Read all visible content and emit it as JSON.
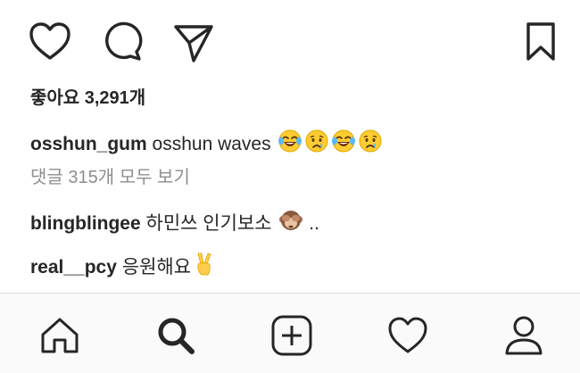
{
  "post": {
    "likes_text": "좋아요 3,291개",
    "caption": {
      "username": "osshun_gum",
      "text": "osshun waves",
      "emojis": [
        "face-with-tears-of-joy",
        "crying-face",
        "face-with-tears-of-joy",
        "crying-face"
      ]
    },
    "view_all_comments": "댓글 315개 모두 보기",
    "comments": [
      {
        "username": "blingblingee",
        "text": "하민쓰 인기보소",
        "emoji": "see-no-evil-monkey",
        "suffix": ".."
      },
      {
        "username": "real__pcy",
        "text": "응원해요",
        "emoji": "victory-hand"
      }
    ]
  },
  "actions": [
    "heart-icon",
    "comment-icon",
    "share-icon",
    "bookmark-icon"
  ],
  "tabbar": {
    "tabs": [
      "home-icon",
      "search-icon",
      "new-post-icon",
      "activity-icon",
      "profile-icon"
    ],
    "active_tab": "search-icon"
  },
  "colors": {
    "text": "#262626",
    "secondary_text": "#8e8e8e",
    "tabbar_bg": "#fafafa",
    "divider": "#dbdbdb"
  }
}
